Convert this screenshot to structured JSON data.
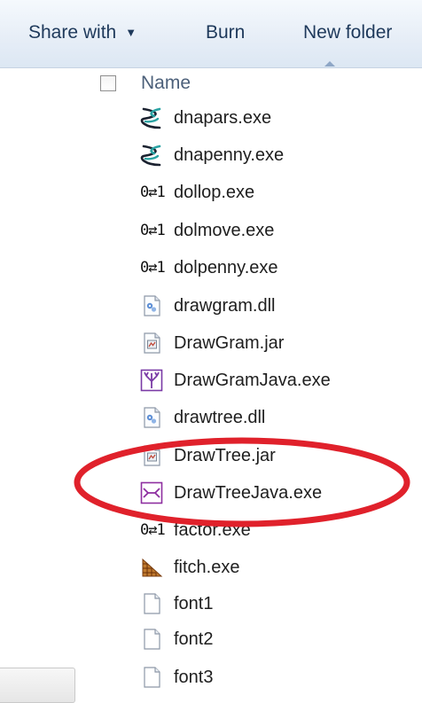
{
  "toolbar": {
    "share_label": "Share with",
    "share_arrow": "▼",
    "burn_label": "Burn",
    "new_folder_label": "New folder"
  },
  "columns": {
    "name_label": "Name"
  },
  "files": [
    {
      "name": "dnapars.exe",
      "icon": "dna-helix-icon"
    },
    {
      "name": "dnapenny.exe",
      "icon": "dna-helix-icon"
    },
    {
      "name": "dollop.exe",
      "icon": "binary-console-icon"
    },
    {
      "name": "dolmove.exe",
      "icon": "binary-console-icon"
    },
    {
      "name": "dolpenny.exe",
      "icon": "binary-console-icon"
    },
    {
      "name": "drawgram.dll",
      "icon": "dll-file-icon"
    },
    {
      "name": "DrawGram.jar",
      "icon": "jar-file-icon"
    },
    {
      "name": "DrawGramJava.exe",
      "icon": "drawgram-tree-icon"
    },
    {
      "name": "drawtree.dll",
      "icon": "dll-file-icon"
    },
    {
      "name": "DrawTree.jar",
      "icon": "jar-file-icon"
    },
    {
      "name": "DrawTreeJava.exe",
      "icon": "drawtree-unrooted-icon"
    },
    {
      "name": "factor.exe",
      "icon": "binary-console-icon"
    },
    {
      "name": "fitch.exe",
      "icon": "fitch-triangle-icon"
    },
    {
      "name": "font1",
      "icon": "blank-file-icon"
    },
    {
      "name": "font2",
      "icon": "blank-file-icon"
    },
    {
      "name": "font3",
      "icon": "blank-file-icon"
    }
  ],
  "annotation": {
    "color": "#e0212b",
    "highlighted_file": "DrawTreeJava.exe"
  }
}
